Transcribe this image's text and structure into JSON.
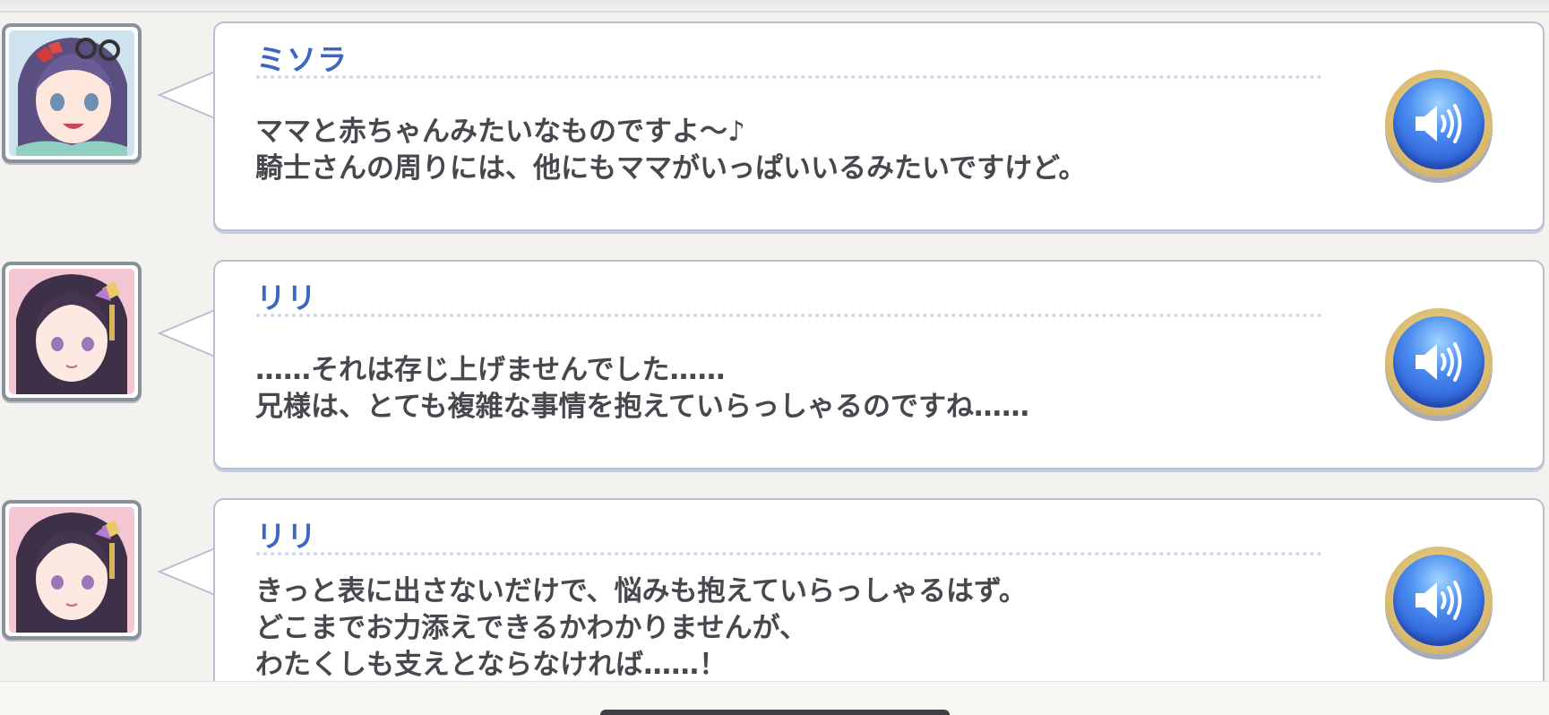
{
  "log": {
    "entries": [
      {
        "speaker": "ミソラ",
        "avatar_icon": "misora-portrait-icon",
        "lines": [
          "ママと赤ちゃんみたいなものですよ～♪",
          "騎士さんの周りには、他にもママがいっぱいいるみたいですけど。"
        ],
        "voice_icon": "speaker-volume-icon"
      },
      {
        "speaker": "リリ",
        "avatar_icon": "riri-portrait-icon",
        "lines": [
          "……それは存じ上げませんでした……",
          "兄様は、とても複雑な事情を抱えていらっしゃるのですね……"
        ],
        "voice_icon": "speaker-volume-icon"
      },
      {
        "speaker": "リリ",
        "avatar_icon": "riri-portrait-icon",
        "lines": [
          "きっと表に出さないだけで、悩みも抱えていらっしゃるはず。",
          "どこまでお力添えできるかわかりませんが、",
          "わたくしも支えとならなければ……！"
        ],
        "voice_icon": "speaker-volume-icon"
      }
    ]
  },
  "colors": {
    "speaker_name": "#3c66c4",
    "dialogue_text": "#47474d",
    "voice_button": "#2f63d9",
    "voice_ring": "#d7b76a"
  }
}
